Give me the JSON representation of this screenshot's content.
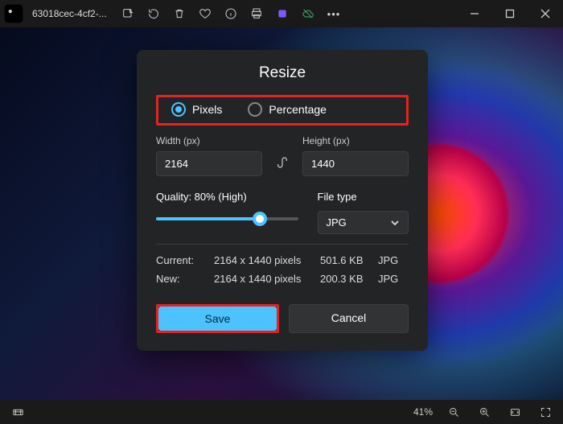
{
  "title": {
    "filename": "63018cec-4cf2-..."
  },
  "dialog": {
    "title": "Resize",
    "mode": {
      "pixels_label": "Pixels",
      "percentage_label": "Percentage",
      "selected": "pixels"
    },
    "width_label": "Width  (px)",
    "height_label": "Height  (px)",
    "width_value": "2164",
    "height_value": "1440",
    "quality_label": "Quality: 80% (High)",
    "quality_percent": 80,
    "filetype_label": "File type",
    "filetype_value": "JPG",
    "current_label": "Current:",
    "new_label": "New:",
    "current_dims": "2164 x 1440 pixels",
    "current_size": "501.6 KB",
    "current_fmt": "JPG",
    "new_dims": "2164 x 1440 pixels",
    "new_size": "200.3 KB",
    "new_fmt": "JPG",
    "save_label": "Save",
    "cancel_label": "Cancel"
  },
  "status": {
    "zoom": "41%"
  },
  "icons": {
    "ellipsis": "•••"
  }
}
